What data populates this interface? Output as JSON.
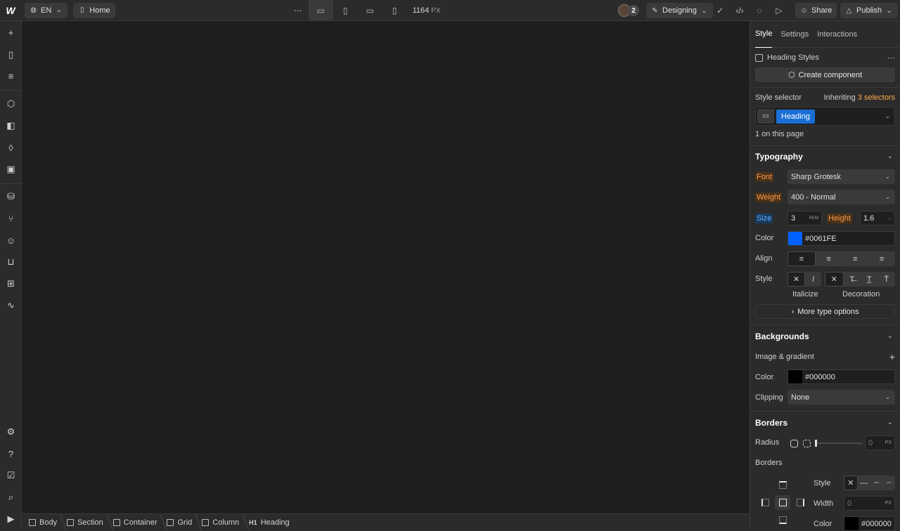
{
  "topbar": {
    "language": "EN",
    "page": "Home",
    "width_value": "1164",
    "width_unit": "PX",
    "collaborator_count": "2",
    "mode": "Designing",
    "share_label": "Share",
    "publish_label": "Publish"
  },
  "breadcrumbs": [
    {
      "label": "Body"
    },
    {
      "label": "Section"
    },
    {
      "label": "Container"
    },
    {
      "label": "Grid"
    },
    {
      "label": "Column"
    },
    {
      "label": "Heading",
      "tag": "H1"
    }
  ],
  "panel": {
    "tabs": [
      "Style",
      "Settings",
      "Interactions"
    ],
    "heading_styles": "Heading Styles",
    "create_component": "Create component",
    "style_selector_label": "Style selector",
    "inheriting_prefix": "Inheriting",
    "inheriting_count": "3 selectors",
    "selector_chip": "Heading",
    "on_page": "1 on this page",
    "typography": {
      "title": "Typography",
      "font_label": "Font",
      "font_value": "Sharp Grotesk",
      "weight_label": "Weight",
      "weight_value": "400 - Normal",
      "size_label": "Size",
      "size_value": "3",
      "size_unit": "REM",
      "height_label": "Height",
      "height_value": "1.6",
      "height_unit": "-",
      "color_label": "Color",
      "color_value": "#0061FE",
      "color_swatch": "#0061FE",
      "align_label": "Align",
      "style_label": "Style",
      "italicize_label": "Italicize",
      "decoration_label": "Decoration",
      "more_options": "More type options"
    },
    "backgrounds": {
      "title": "Backgrounds",
      "image_gradient_label": "Image & gradient",
      "color_label": "Color",
      "color_value": "#000000",
      "color_swatch": "#000000",
      "clipping_label": "Clipping",
      "clipping_value": "None"
    },
    "borders": {
      "title": "Borders",
      "radius_label": "Radius",
      "radius_value": "0",
      "radius_unit": "PX",
      "borders_label": "Borders",
      "style_label": "Style",
      "width_label": "Width",
      "width_value": "0",
      "width_unit": "PX",
      "color_label": "Color",
      "color_value": "#000000",
      "color_swatch": "#000000"
    }
  },
  "colors": {
    "accent_blue": "#0061FE",
    "chip_blue": "#1a6fd6",
    "inherit_orange": "#ffa94d"
  }
}
